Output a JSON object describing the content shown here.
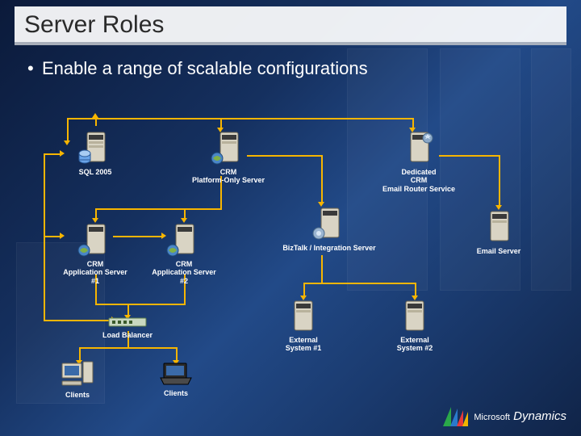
{
  "title": "Server Roles",
  "bullet": "Enable a range of scalable configurations",
  "nodes": {
    "sql": {
      "label": "SQL 2005"
    },
    "crm_plat": {
      "label": "CRM\nPlatform-Only Server"
    },
    "ded_email": {
      "label": "Dedicated\nCRM\nEmail Router Service"
    },
    "crm_app1": {
      "label": "CRM\nApplication Server #1"
    },
    "crm_app2": {
      "label": "CRM\nApplication Server #2"
    },
    "biztalk": {
      "label": "BizTalk / Integration Server"
    },
    "email_srv": {
      "label": "Email Server"
    },
    "load_bal": {
      "label": "Load Balancer"
    },
    "clients1": {
      "label": "Clients"
    },
    "clients2": {
      "label": "Clients"
    },
    "ext1": {
      "label": "External\nSystem #1"
    },
    "ext2": {
      "label": "External\nSystem #2"
    }
  },
  "brand": {
    "line1": "Microsoft",
    "line2": "Dynamics"
  },
  "icons": {
    "server": "server-tower-icon",
    "db": "database-cylinder-icon",
    "globe": "globe-icon",
    "gear": "gear-icon",
    "switch": "network-switch-icon",
    "desktop": "desktop-computer-icon",
    "laptop": "laptop-icon"
  },
  "accent": "#f7b500"
}
